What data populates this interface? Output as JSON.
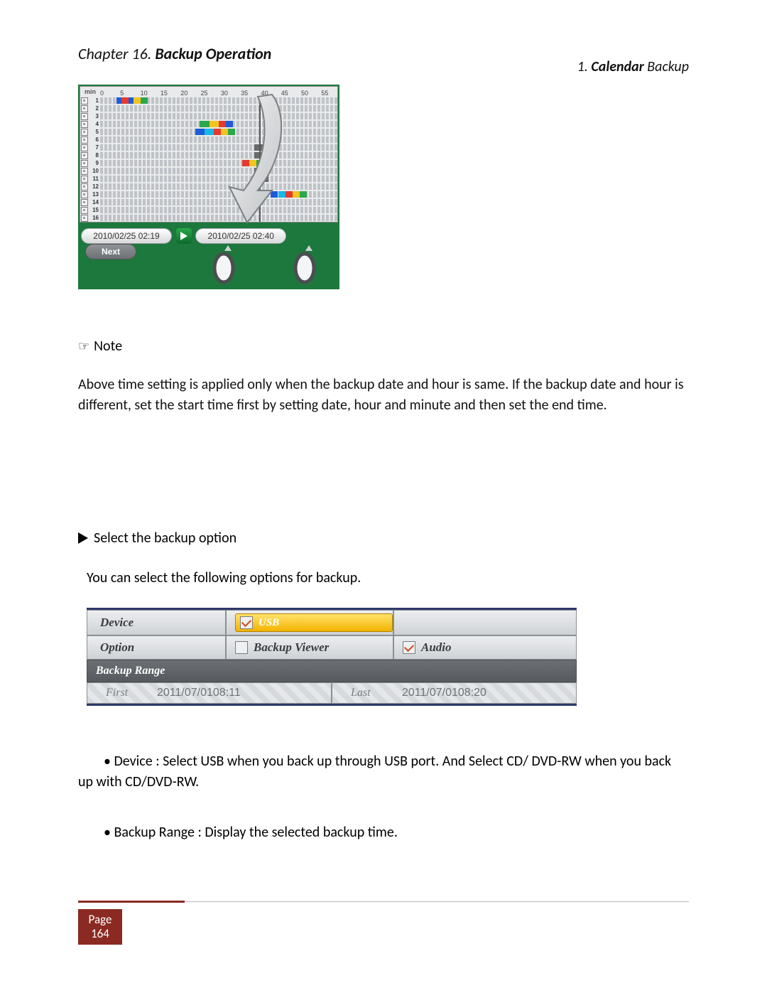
{
  "header": {
    "chapter_prefix": "Chapter 16. ",
    "chapter_title": "Backup Operation",
    "section_num": "1. ",
    "section_bold": "Calendar",
    "section_rest": " Backup"
  },
  "timeline": {
    "min_label": "min",
    "ticks": [
      "0",
      "5",
      "10",
      "15",
      "20",
      "25",
      "30",
      "35",
      "40",
      "45",
      "50",
      "55"
    ],
    "rows": [
      1,
      2,
      3,
      4,
      5,
      6,
      7,
      8,
      9,
      10,
      11,
      12,
      13,
      14,
      15,
      16
    ],
    "playhead_pct": 67,
    "start_pill": "2010/02/25   02:19",
    "end_pill": "2010/02/25   02:40",
    "next_label": "Next",
    "color_runs": {
      "1": [
        {
          "l": 7,
          "w": 12,
          "c": "c-blue"
        },
        {
          "l": 9,
          "w": 3,
          "c": "c-red"
        },
        {
          "l": 14,
          "w": 3,
          "c": "c-yel"
        },
        {
          "l": 17,
          "w": 3,
          "c": "c-grn"
        }
      ],
      "4": [
        {
          "l": 42,
          "w": 4,
          "c": "c-grn"
        },
        {
          "l": 46,
          "w": 4,
          "c": "c-yel"
        },
        {
          "l": 50,
          "w": 3,
          "c": "c-red"
        },
        {
          "l": 53,
          "w": 3,
          "c": "c-blue"
        }
      ],
      "5": [
        {
          "l": 40,
          "w": 4,
          "c": "c-blue"
        },
        {
          "l": 44,
          "w": 4,
          "c": "c-cyan"
        },
        {
          "l": 48,
          "w": 3,
          "c": "c-red"
        },
        {
          "l": 51,
          "w": 3,
          "c": "c-yel"
        },
        {
          "l": 54,
          "w": 3,
          "c": "c-grn"
        }
      ],
      "7": [
        {
          "l": 65,
          "w": 6,
          "c": "c-dk"
        }
      ],
      "8": [
        {
          "l": 65,
          "w": 6,
          "c": "c-dk"
        }
      ],
      "9": [
        {
          "l": 60,
          "w": 3,
          "c": "c-red"
        },
        {
          "l": 63,
          "w": 3,
          "c": "c-yel"
        },
        {
          "l": 66,
          "w": 3,
          "c": "c-grn"
        }
      ],
      "10": [
        {
          "l": 65,
          "w": 6,
          "c": "c-dk"
        }
      ],
      "11": [
        {
          "l": 65,
          "w": 6,
          "c": "c-dk"
        }
      ],
      "13": [
        {
          "l": 72,
          "w": 3,
          "c": "c-blue"
        },
        {
          "l": 75,
          "w": 3,
          "c": "c-cyan"
        },
        {
          "l": 78,
          "w": 3,
          "c": "c-red"
        },
        {
          "l": 81,
          "w": 3,
          "c": "c-yel"
        },
        {
          "l": 84,
          "w": 3,
          "c": "c-grn"
        }
      ]
    }
  },
  "note": {
    "symbol": "☞",
    "label": "Note",
    "body": "Above time setting is applied only when the backup date and hour is same. If the backup date and hour is different, set the start time first by setting date, hour and minute and then set the end time."
  },
  "section": {
    "title": "Select the backup option",
    "intro": "You can select the following options for backup."
  },
  "options": {
    "device_label": "Device",
    "device_value": "USB",
    "option_label": "Option",
    "backup_viewer": "Backup Viewer",
    "audio": "Audio",
    "range_band": "Backup Range",
    "first_label": "First",
    "first_value": "2011/07/0108:11",
    "last_label": "Last",
    "last_value": "2011/07/0108:20"
  },
  "bullets": {
    "b1": "• Device : Select USB when you back up through USB port. And Select CD/ DVD-RW when you back up with CD/DVD-RW.",
    "b2": "• Backup Range : Display the selected backup time."
  },
  "footer": {
    "page_word": "Page",
    "page_num": "164"
  }
}
